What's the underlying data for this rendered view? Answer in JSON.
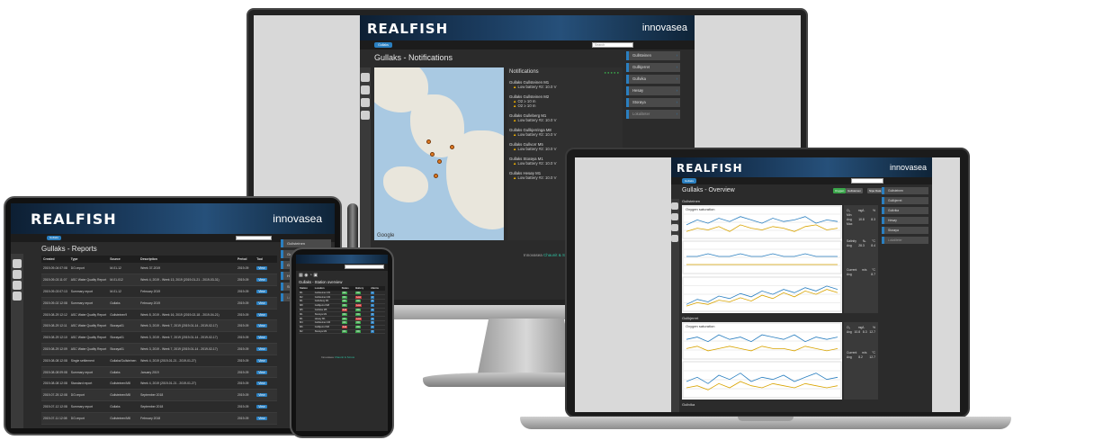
{
  "brand": {
    "logo": "REALFISH",
    "company": "innovasea"
  },
  "monitor": {
    "nav_button": "Gullaks",
    "search_placeholder": "Search",
    "page_title": "Gullaks - Notifications",
    "notifications_title": "Notifications",
    "map_label": "Google",
    "notifications": [
      {
        "site": "Gullaks Gullsteinen M1",
        "rows": [
          "Low battery #2: 10.0 V"
        ]
      },
      {
        "site": "Gullaks Gullsteinen M2",
        "rows": [
          "O2 ≥ 10 m",
          "O2 ≥ 10 m"
        ]
      },
      {
        "site": "Gullaks Gulleberg M1",
        "rows": [
          "Low battery #2: 10.0 V"
        ]
      },
      {
        "site": "Gullaks Gullkjerringa M8",
        "rows": [
          "Low battery #2: 10.0 V"
        ]
      },
      {
        "site": "Gullaks Gullvorr M5",
        "rows": [
          "Low battery #2: 10.0 V"
        ]
      },
      {
        "site": "Gullaks Storøya M1",
        "rows": [
          "Low battery #2: 10.0 V"
        ]
      },
      {
        "site": "Gullaks Hesøy M1",
        "rows": [
          "Low battery #2: 10.0 V"
        ]
      }
    ],
    "menu": [
      "Gullsteinen",
      "Gullkjerret",
      "Gullvika",
      "Hesøy",
      "Storøya",
      "Lokaliteter"
    ],
    "footer_text": "Innovasea",
    "footer_link": "Chaunit & Scrow"
  },
  "laptop": {
    "nav_button": "Gullaks",
    "page_title": "Gullaks - Overview",
    "buttons": [
      "Oxygen",
      "Gullsteinen",
      "Nipe Data"
    ],
    "sections": [
      "Gullsteinen",
      "Gullkjerret",
      "Gullvika"
    ],
    "chart_titles": [
      "Oxygen saturation",
      "Salinity",
      "Oxygen saturation"
    ],
    "menu": [
      "Gullsteinen",
      "Gullkjerret",
      "Gullvika",
      "Hesøy",
      "Storøya",
      "Lokaliteter"
    ],
    "stats": {
      "header": [
        "O₂",
        "mg/L",
        "%"
      ],
      "rows": [
        [
          "Min",
          "",
          ""
        ],
        [
          "Avg",
          "10.8",
          "8.3"
        ],
        [
          "Max",
          "",
          ""
        ]
      ],
      "salinity": [
        "Salinity",
        "‰",
        "°C"
      ],
      "salinity_row": [
        "Avg",
        "28.3",
        "8.4"
      ],
      "current": [
        "Current",
        "m/s",
        "°C"
      ],
      "current_row": [
        "Avg",
        "",
        "8.7"
      ],
      "o2b": [
        "Avg",
        "10.8",
        "8.3",
        "12.7"
      ],
      "current_b": [
        "Avg",
        "8.2",
        "12.7"
      ]
    }
  },
  "tablet": {
    "nav_button": "Gullaks",
    "page_title": "Gullaks - Reports",
    "columns": [
      "Created",
      "Type",
      "Source",
      "Description",
      "Period",
      "Tool"
    ],
    "rows": [
      [
        "2019-09-04 07:08",
        "DO-report",
        "M-01-12",
        "Week 37-2019",
        "2019-09",
        "View"
      ],
      [
        "2019-09-03 11:07",
        "ASC Water Quality Report",
        "M-01-012",
        "Week 4, 2019 - Week 13, 2019 (2019-01-21 - 2019-03-31)",
        "2019-09",
        "View"
      ],
      [
        "2019-09-03 07:13",
        "Summary report",
        "M-01-12",
        "February 2019",
        "2019-09",
        "View"
      ],
      [
        "2019-09-02 12:08",
        "Summary report",
        "Gullaks",
        "February 2019",
        "2019-09",
        "View"
      ],
      [
        "2019-08-29 12:12",
        "ASC Water Quality Report",
        "Gullsteinen9",
        "Week 8, 2019 - Week 16, 2019 (2019-02-18 - 2019-04-21)",
        "2019-09",
        "View"
      ],
      [
        "2019-08-29 12:11",
        "ASC Water Quality Report",
        "Storøya01",
        "Week 3, 2019 - Week 7, 2019 (2019-01-14 - 2019-02-17)",
        "2019-09",
        "View"
      ],
      [
        "2019-08-29 12:10",
        "ASC Water Quality Report",
        "Storøya01",
        "Week 3, 2019 - Week 7, 2019 (2019-01-14 - 2019-02-17)",
        "2019-09",
        "View"
      ],
      [
        "2019-08-29 12:09",
        "ASC Water Quality Report",
        "Storøya01",
        "Week 3, 2019 - Week 7, 2019 (2019-01-14 - 2019-02-17)",
        "2019-09",
        "View"
      ],
      [
        "2019-08-08 12:08",
        "Single settlement",
        "Gullaks/Gullsteinen",
        "Week 4, 2019 (2019-01-21 - 2019-01-27)",
        "2019-09",
        "View"
      ],
      [
        "2019-08-08 09:08",
        "Summary report",
        "Gullaks",
        "January 2019",
        "2019-09",
        "View"
      ],
      [
        "2019-08-08 12:08",
        "Standard report",
        "Gullsteinen/M8",
        "Week 4, 2019 (2019-01-21 - 2019-01-27)",
        "2019-09",
        "View"
      ],
      [
        "2019-07-25 12:08",
        "DO-report",
        "Gullsteinen/M8",
        "September 2018",
        "2019-09",
        "View"
      ],
      [
        "2019-07-12 12:08",
        "Summary report",
        "Gullaks",
        "September 2018",
        "2019-09",
        "View"
      ],
      [
        "2019-07-11 12:08",
        "DO-report",
        "Gullsteinen/M8",
        "February 2018",
        "2019-09",
        "View"
      ],
      [
        "2019-07-10 12:08",
        "Standard report",
        "Gullsteinen/M8",
        "February 2018",
        "2019-09",
        "View"
      ]
    ],
    "menu": [
      "Gullsteinen",
      "Gullkjerret",
      "Gullvika",
      "Hesøy",
      "Storøya",
      "Lokaliteter"
    ]
  },
  "phone": {
    "title": "Gullaks - Station overview",
    "columns": [
      "Station",
      "Location",
      "Status",
      "Battery",
      "Alarms"
    ],
    "rows": [
      [
        "M1",
        "Gullsteinen M1",
        "OK",
        "OK",
        "1"
      ],
      [
        "M2",
        "Gullsteinen M2",
        "OK",
        "Low",
        "2"
      ],
      [
        "M1",
        "Gulleberg M1",
        "OK",
        "OK",
        "0"
      ],
      [
        "M8",
        "Gullkjerret M8",
        "OK",
        "Low",
        "1"
      ],
      [
        "M5",
        "Gullvika M5",
        "Fail",
        "OK",
        "0"
      ],
      [
        "M1",
        "Storøya M1",
        "OK",
        "OK",
        "0"
      ],
      [
        "M1",
        "Hesøy M1",
        "OK",
        "Low",
        "3"
      ],
      [
        "M4",
        "Gullsteinen M4",
        "OK",
        "OK",
        "0"
      ],
      [
        "M6",
        "Gullkjerret M6",
        "Fail",
        "OK",
        "2"
      ],
      [
        "M2",
        "Storøya M2",
        "OK",
        "OK",
        "0"
      ]
    ],
    "footer_text": "Innovasea",
    "footer_link": "Chaunit & Scrow"
  },
  "colors": {
    "accent": "#2a7fc0",
    "ok": "#3aa54a",
    "fail": "#c83a3a",
    "warn": "#f0b000",
    "teal": "#2fbfa0"
  },
  "chart_data": [
    {
      "type": "line",
      "title": "Oxygen saturation",
      "series": [
        {
          "values": [
            92,
            95,
            93,
            96,
            94,
            97,
            95,
            93,
            96,
            94,
            95,
            97,
            93,
            95,
            94
          ]
        },
        {
          "values": [
            88,
            90,
            89,
            91,
            88,
            92,
            90,
            89,
            91,
            90,
            88,
            91,
            92,
            89,
            90
          ]
        }
      ]
    },
    {
      "type": "line",
      "title": "Salinity",
      "series": [
        {
          "values": [
            30,
            30,
            31,
            30,
            30,
            31,
            30,
            30,
            31,
            30,
            30,
            31,
            30,
            30,
            30
          ]
        },
        {
          "values": [
            27,
            27,
            27,
            27,
            27,
            27,
            27,
            27,
            27,
            27,
            27,
            27,
            27,
            27,
            27
          ]
        }
      ]
    },
    {
      "type": "line",
      "title": "Current",
      "series": [
        {
          "values": [
            12,
            18,
            15,
            22,
            19,
            25,
            21,
            28,
            24,
            30,
            26,
            32,
            28,
            34,
            30
          ]
        },
        {
          "values": [
            10,
            14,
            12,
            17,
            15,
            20,
            16,
            23,
            19,
            26,
            21,
            28,
            24,
            30,
            26
          ]
        }
      ]
    },
    {
      "type": "line",
      "title": "Oxygen saturation",
      "series": [
        {
          "values": [
            94,
            95,
            93,
            96,
            94,
            95,
            93,
            96,
            95,
            94,
            96,
            93,
            95,
            94,
            95
          ]
        },
        {
          "values": [
            90,
            91,
            89,
            90,
            91,
            90,
            89,
            91,
            90,
            90,
            89,
            91,
            90,
            89,
            90
          ]
        }
      ]
    },
    {
      "type": "line",
      "title": "Current",
      "series": [
        {
          "values": [
            15,
            17,
            14,
            18,
            16,
            19,
            15,
            17,
            16,
            18,
            15,
            17,
            19,
            16,
            17
          ]
        },
        {
          "values": [
            12,
            13,
            11,
            14,
            12,
            15,
            13,
            12,
            14,
            13,
            12,
            14,
            13,
            12,
            13
          ]
        }
      ]
    }
  ]
}
